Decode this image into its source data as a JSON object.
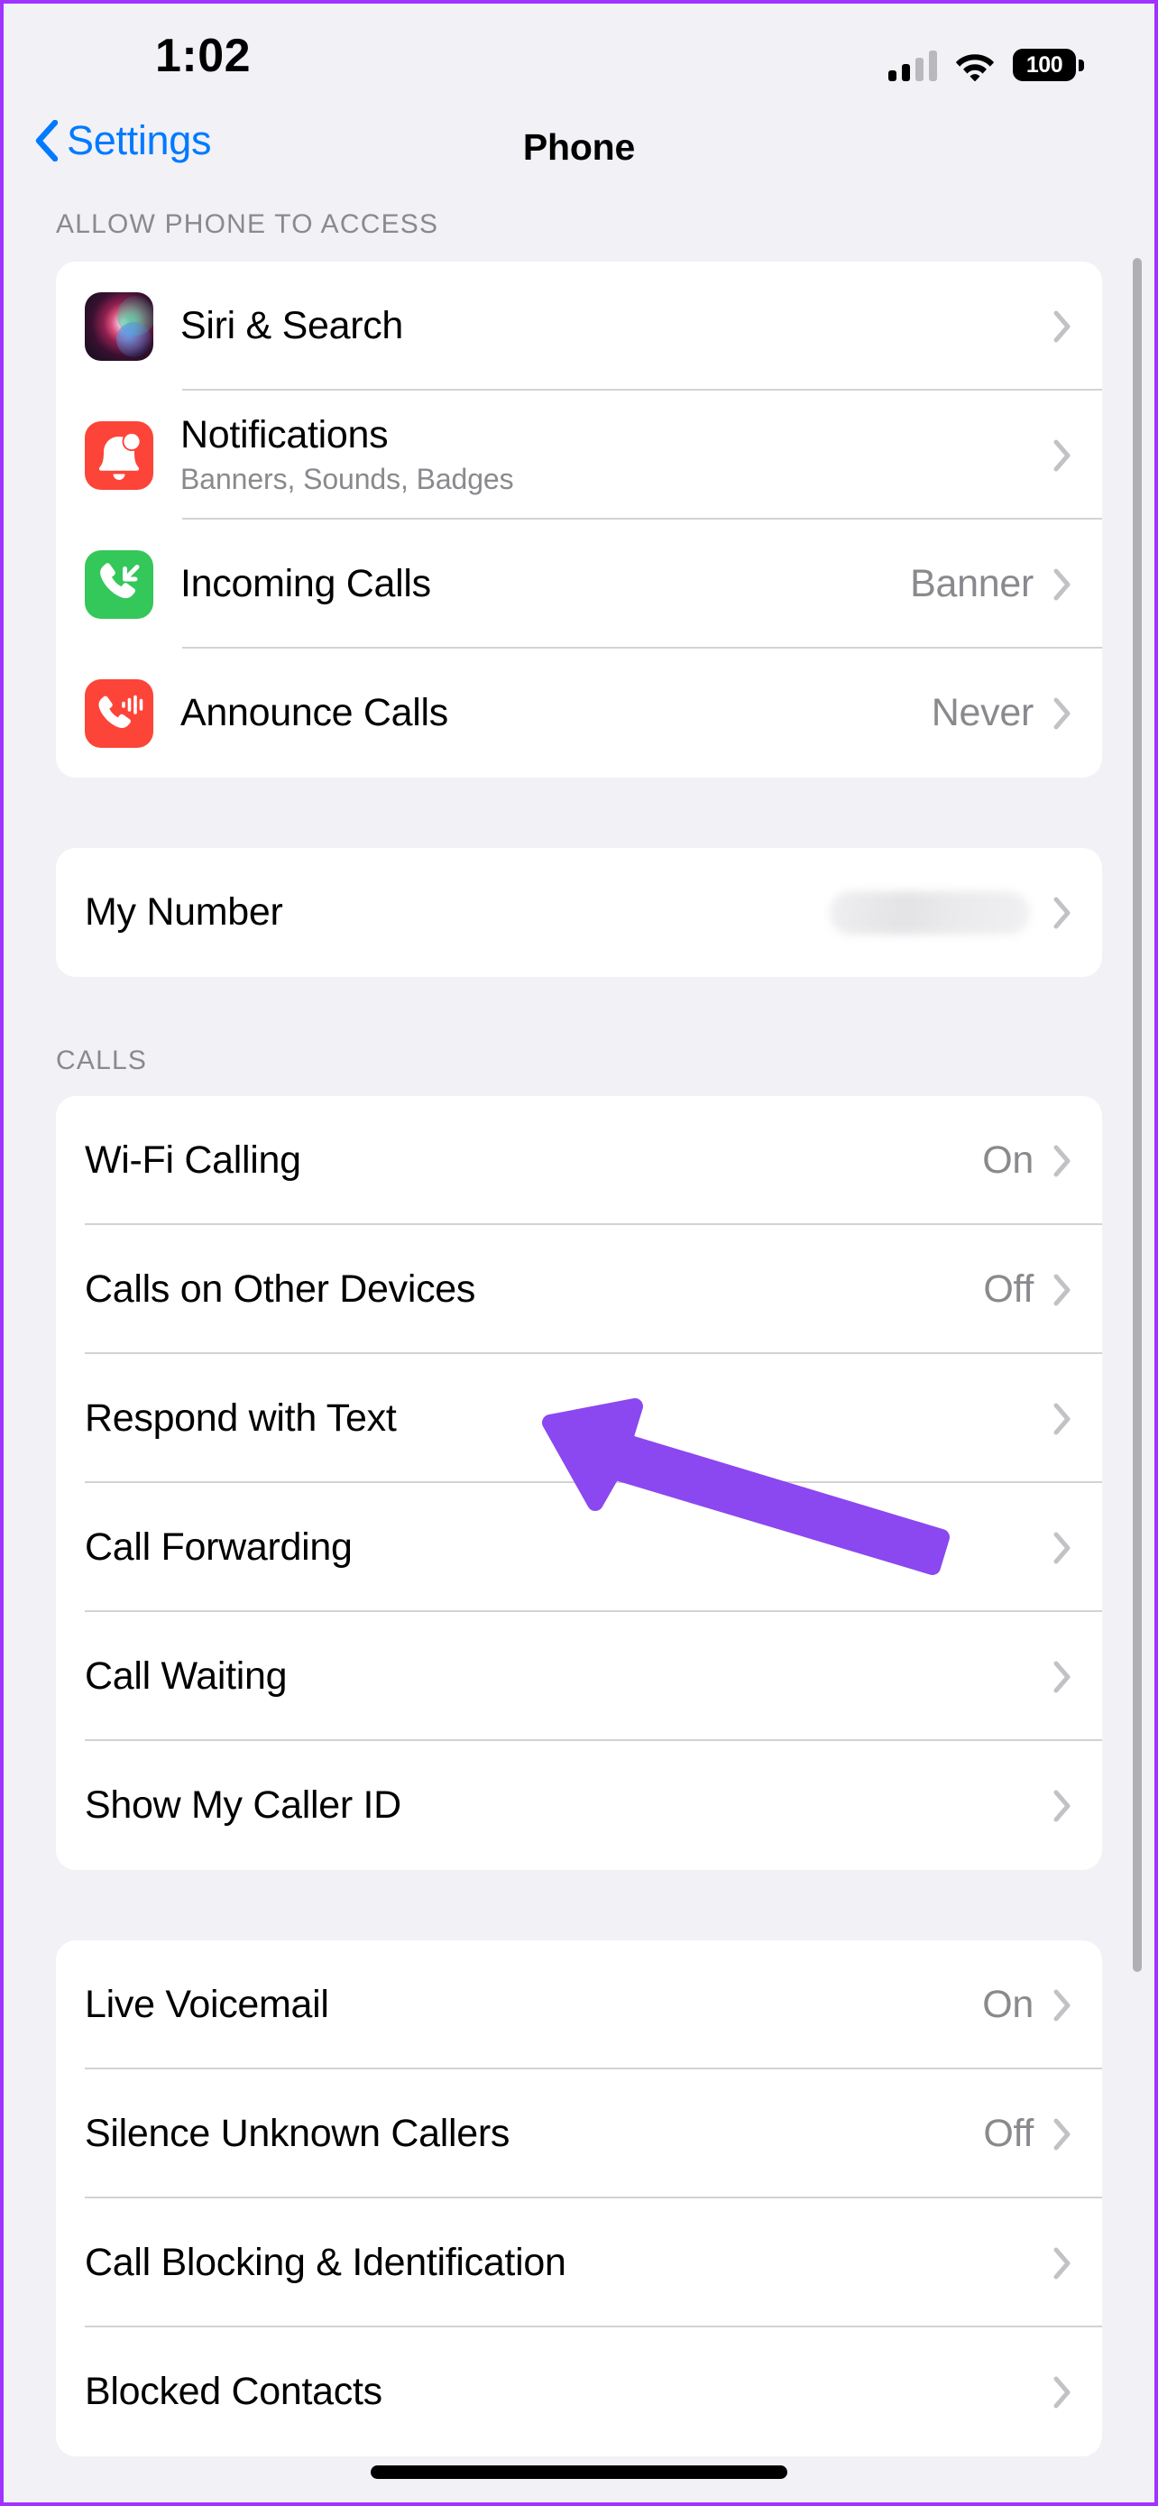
{
  "status_bar": {
    "time": "1:02",
    "battery_percent": "100",
    "signal_icon": "cellular-signal-icon",
    "wifi_icon": "wifi-icon",
    "battery_icon": "battery-icon"
  },
  "nav": {
    "back_label": "Settings",
    "back_icon": "chevron-left-icon",
    "title": "Phone"
  },
  "sections": [
    {
      "header": "ALLOW PHONE TO ACCESS",
      "rows": [
        {
          "title": "Siri & Search",
          "subtitle": "",
          "value": "",
          "icon": "siri-icon"
        },
        {
          "title": "Notifications",
          "subtitle": "Banners, Sounds, Badges",
          "value": "",
          "icon": "notifications-bell-icon"
        },
        {
          "title": "Incoming Calls",
          "subtitle": "",
          "value": "Banner",
          "icon": "incoming-call-icon"
        },
        {
          "title": "Announce Calls",
          "subtitle": "",
          "value": "Never",
          "icon": "announce-calls-icon"
        }
      ]
    },
    {
      "header": "",
      "rows": [
        {
          "title": "My Number",
          "subtitle": "",
          "value": "",
          "redacted": true
        }
      ]
    },
    {
      "header": "CALLS",
      "rows": [
        {
          "title": "Wi-Fi Calling",
          "subtitle": "",
          "value": "On"
        },
        {
          "title": "Calls on Other Devices",
          "subtitle": "",
          "value": "Off"
        },
        {
          "title": "Respond with Text",
          "subtitle": "",
          "value": ""
        },
        {
          "title": "Call Forwarding",
          "subtitle": "",
          "value": ""
        },
        {
          "title": "Call Waiting",
          "subtitle": "",
          "value": ""
        },
        {
          "title": "Show My Caller ID",
          "subtitle": "",
          "value": ""
        }
      ]
    },
    {
      "header": "",
      "rows": [
        {
          "title": "Live Voicemail",
          "subtitle": "",
          "value": "On"
        },
        {
          "title": "Silence Unknown Callers",
          "subtitle": "",
          "value": "Off"
        },
        {
          "title": "Call Blocking & Identification",
          "subtitle": "",
          "value": ""
        },
        {
          "title": "Blocked Contacts",
          "subtitle": "",
          "value": ""
        }
      ]
    }
  ],
  "annotation": {
    "type": "arrow",
    "points_at": "Calls on Other Devices",
    "color": "#8B47F0"
  },
  "colors": {
    "background": "#F2F1F6",
    "card": "#FFFFFF",
    "accent_blue": "#007AFF",
    "secondary_text": "#8A8A8E",
    "annotation_purple": "#8B47F0",
    "border_purple": "#A033FF",
    "icon_red": "#FD4438",
    "icon_green": "#34C759"
  }
}
